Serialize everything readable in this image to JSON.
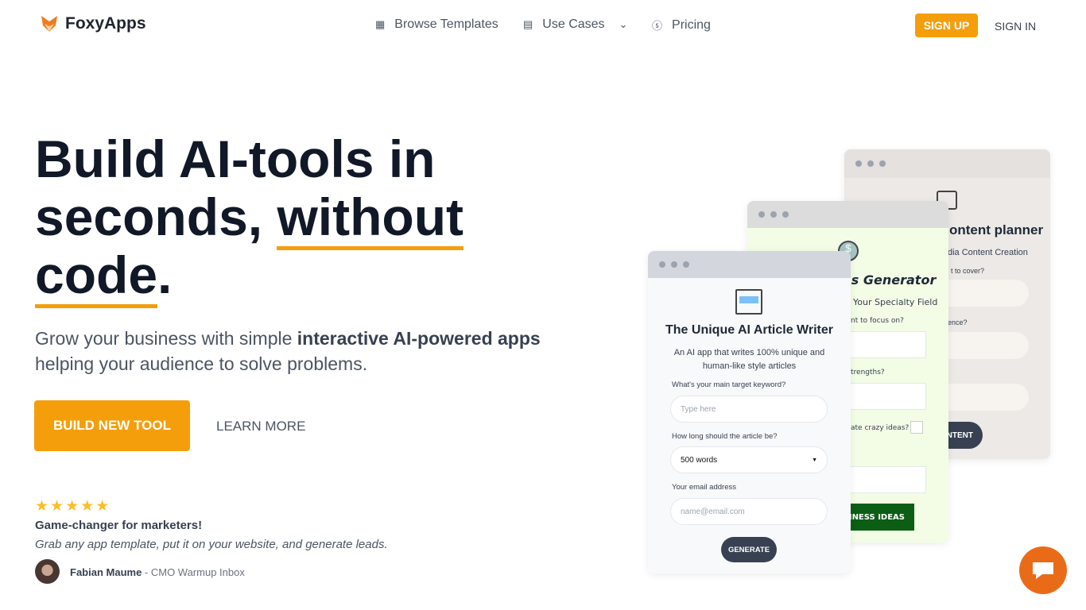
{
  "nav": {
    "brand": "FoxyApps",
    "links": [
      {
        "label": "Browse Templates",
        "icon": "grid-icon"
      },
      {
        "label": "Use Cases",
        "icon": "receipt-icon",
        "dropdown": true
      },
      {
        "label": "Pricing",
        "icon": "dollar-circle-icon"
      }
    ],
    "signup": "SIGN UP",
    "signin": "SIGN IN",
    "accent": "#f59e0b"
  },
  "hero": {
    "title_part1": "Build AI-tools in seconds, ",
    "title_underline1": "without",
    "title_underline2": "code",
    "title_end": ".",
    "subtitle_start": "Grow your business with simple ",
    "subtitle_bold": "interactive AI-powered apps",
    "subtitle_end": " helping your audience to solve problems.",
    "build_button": "BUILD NEW TOOL",
    "learn_more": "LEARN MORE"
  },
  "testimonial": {
    "rating": 5,
    "stars": "★★★★★",
    "title": "Game-changer for marketers!",
    "quote": "Grab any app template, put it on your website, and generate leads.",
    "author": "Fabian Maume",
    "role": " - CMO Warmup Inbox"
  },
  "cards": {
    "back": {
      "title": "ontent planner",
      "subtitle": "dia Content Creation",
      "q1": "t to cover?",
      "q2": "ence?",
      "button": "NTENT"
    },
    "middle": {
      "title": "as Generator",
      "subtitle": "Your Specialty Field",
      "q1": "nt to focus on?",
      "q2": "trengths?",
      "q3": "ate crazy ideas?",
      "button": "INESS IDEAS"
    },
    "front": {
      "title": "The Unique AI Article Writer",
      "description": "An AI app that writes 100% unique and human-like style articles",
      "q1": "What's your main target keyword?",
      "q1_placeholder": "Type here",
      "q2": "How long should the article be?",
      "q2_value": "500 words",
      "q3": "Your email address",
      "q3_placeholder": "name@email.com",
      "button": "GENERATE"
    }
  }
}
